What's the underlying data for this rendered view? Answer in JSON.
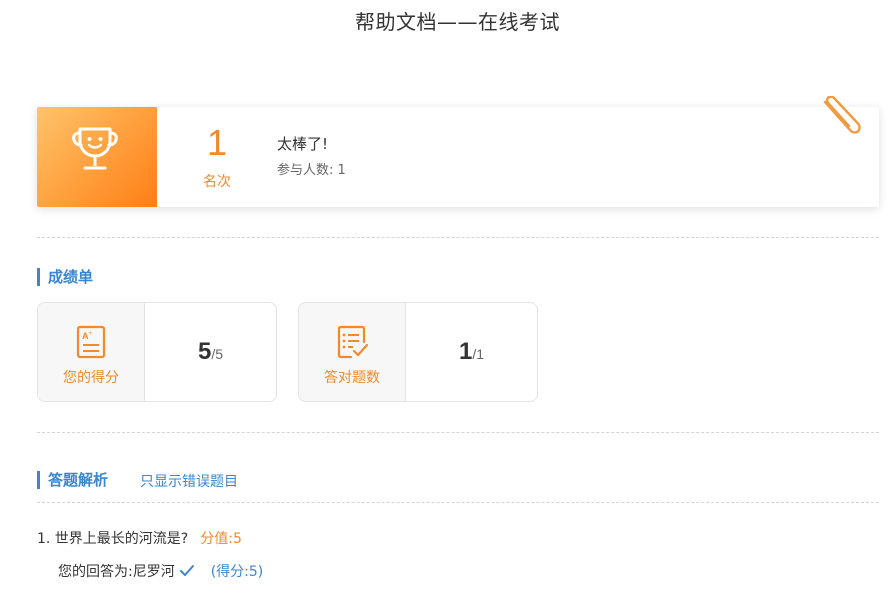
{
  "page": {
    "title": "帮助文档——在线考试"
  },
  "rank": {
    "number": "1",
    "label": "名次",
    "headline": "太棒了!",
    "participants_label": "参与人数:",
    "participants_count": "1",
    "icons": {
      "trophy": "trophy-icon",
      "paperclip": "paperclip-icon"
    }
  },
  "scores_section": {
    "title": "成绩单",
    "cards": [
      {
        "label": "您的得分",
        "icon": "score-sheet-icon",
        "value": "5",
        "total": "/5"
      },
      {
        "label": "答对题数",
        "icon": "checklist-icon",
        "value": "1",
        "total": "/1"
      }
    ]
  },
  "analysis_section": {
    "title": "答题解析",
    "wrong_only_link": "只显示错误题目",
    "questions": [
      {
        "text": "1. 世界上最长的河流是?",
        "points": "分值:5",
        "answer_label": "您的回答为:",
        "answer": "尼罗河",
        "result_icon": "checkmark-icon",
        "score": "(得分:5)"
      }
    ]
  },
  "colors": {
    "accent_orange": "#f08a2b",
    "accent_blue": "#3a86cf",
    "text_dark": "#333333"
  }
}
